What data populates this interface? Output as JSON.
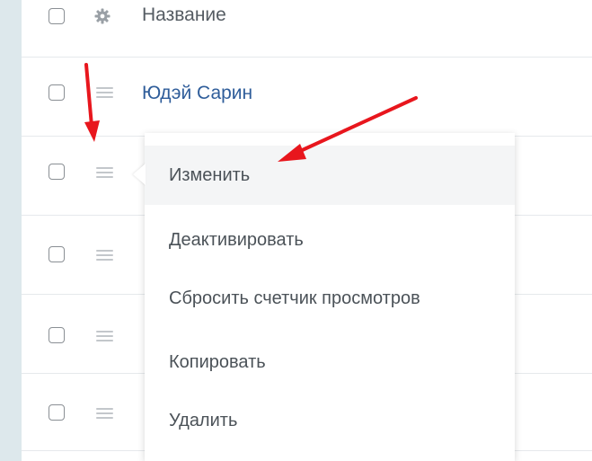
{
  "table": {
    "header": {
      "title": "Название",
      "settings_icon": "gear-icon"
    },
    "rows": [
      {
        "name": "Юдэй Сарин",
        "handle_icon": "drag-handle-icon"
      },
      {
        "name": "",
        "handle_icon": "drag-handle-icon"
      },
      {
        "name": "",
        "handle_icon": "drag-handle-icon"
      },
      {
        "name": "",
        "handle_icon": "drag-handle-icon"
      },
      {
        "name": "",
        "handle_icon": "drag-handle-icon"
      }
    ]
  },
  "context_menu": {
    "items": [
      {
        "label": "Изменить",
        "highlighted": true
      },
      {
        "label": "Деактивировать",
        "highlighted": false
      },
      {
        "label": "Сбросить счетчик просмотров",
        "highlighted": false
      },
      {
        "label": "Копировать",
        "highlighted": false
      },
      {
        "label": "Удалить",
        "highlighted": false
      }
    ]
  },
  "annotations": {
    "arrow_color": "#e8161d"
  },
  "colors": {
    "link": "#2f5d9a",
    "strip": "#dde8ec"
  }
}
